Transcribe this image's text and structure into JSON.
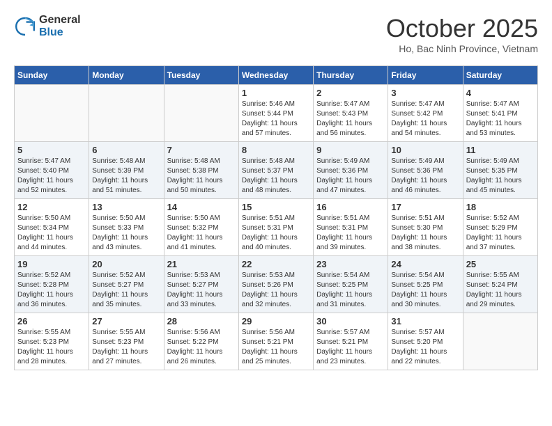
{
  "header": {
    "logo_general": "General",
    "logo_blue": "Blue",
    "month_title": "October 2025",
    "location": "Ho, Bac Ninh Province, Vietnam"
  },
  "days_of_week": [
    "Sunday",
    "Monday",
    "Tuesday",
    "Wednesday",
    "Thursday",
    "Friday",
    "Saturday"
  ],
  "weeks": [
    [
      {
        "day": "",
        "sunrise": "",
        "sunset": "",
        "daylight": ""
      },
      {
        "day": "",
        "sunrise": "",
        "sunset": "",
        "daylight": ""
      },
      {
        "day": "",
        "sunrise": "",
        "sunset": "",
        "daylight": ""
      },
      {
        "day": "1",
        "sunrise": "Sunrise: 5:46 AM",
        "sunset": "Sunset: 5:44 PM",
        "daylight": "Daylight: 11 hours and 57 minutes."
      },
      {
        "day": "2",
        "sunrise": "Sunrise: 5:47 AM",
        "sunset": "Sunset: 5:43 PM",
        "daylight": "Daylight: 11 hours and 56 minutes."
      },
      {
        "day": "3",
        "sunrise": "Sunrise: 5:47 AM",
        "sunset": "Sunset: 5:42 PM",
        "daylight": "Daylight: 11 hours and 54 minutes."
      },
      {
        "day": "4",
        "sunrise": "Sunrise: 5:47 AM",
        "sunset": "Sunset: 5:41 PM",
        "daylight": "Daylight: 11 hours and 53 minutes."
      }
    ],
    [
      {
        "day": "5",
        "sunrise": "Sunrise: 5:47 AM",
        "sunset": "Sunset: 5:40 PM",
        "daylight": "Daylight: 11 hours and 52 minutes."
      },
      {
        "day": "6",
        "sunrise": "Sunrise: 5:48 AM",
        "sunset": "Sunset: 5:39 PM",
        "daylight": "Daylight: 11 hours and 51 minutes."
      },
      {
        "day": "7",
        "sunrise": "Sunrise: 5:48 AM",
        "sunset": "Sunset: 5:38 PM",
        "daylight": "Daylight: 11 hours and 50 minutes."
      },
      {
        "day": "8",
        "sunrise": "Sunrise: 5:48 AM",
        "sunset": "Sunset: 5:37 PM",
        "daylight": "Daylight: 11 hours and 48 minutes."
      },
      {
        "day": "9",
        "sunrise": "Sunrise: 5:49 AM",
        "sunset": "Sunset: 5:36 PM",
        "daylight": "Daylight: 11 hours and 47 minutes."
      },
      {
        "day": "10",
        "sunrise": "Sunrise: 5:49 AM",
        "sunset": "Sunset: 5:36 PM",
        "daylight": "Daylight: 11 hours and 46 minutes."
      },
      {
        "day": "11",
        "sunrise": "Sunrise: 5:49 AM",
        "sunset": "Sunset: 5:35 PM",
        "daylight": "Daylight: 11 hours and 45 minutes."
      }
    ],
    [
      {
        "day": "12",
        "sunrise": "Sunrise: 5:50 AM",
        "sunset": "Sunset: 5:34 PM",
        "daylight": "Daylight: 11 hours and 44 minutes."
      },
      {
        "day": "13",
        "sunrise": "Sunrise: 5:50 AM",
        "sunset": "Sunset: 5:33 PM",
        "daylight": "Daylight: 11 hours and 43 minutes."
      },
      {
        "day": "14",
        "sunrise": "Sunrise: 5:50 AM",
        "sunset": "Sunset: 5:32 PM",
        "daylight": "Daylight: 11 hours and 41 minutes."
      },
      {
        "day": "15",
        "sunrise": "Sunrise: 5:51 AM",
        "sunset": "Sunset: 5:31 PM",
        "daylight": "Daylight: 11 hours and 40 minutes."
      },
      {
        "day": "16",
        "sunrise": "Sunrise: 5:51 AM",
        "sunset": "Sunset: 5:31 PM",
        "daylight": "Daylight: 11 hours and 39 minutes."
      },
      {
        "day": "17",
        "sunrise": "Sunrise: 5:51 AM",
        "sunset": "Sunset: 5:30 PM",
        "daylight": "Daylight: 11 hours and 38 minutes."
      },
      {
        "day": "18",
        "sunrise": "Sunrise: 5:52 AM",
        "sunset": "Sunset: 5:29 PM",
        "daylight": "Daylight: 11 hours and 37 minutes."
      }
    ],
    [
      {
        "day": "19",
        "sunrise": "Sunrise: 5:52 AM",
        "sunset": "Sunset: 5:28 PM",
        "daylight": "Daylight: 11 hours and 36 minutes."
      },
      {
        "day": "20",
        "sunrise": "Sunrise: 5:52 AM",
        "sunset": "Sunset: 5:27 PM",
        "daylight": "Daylight: 11 hours and 35 minutes."
      },
      {
        "day": "21",
        "sunrise": "Sunrise: 5:53 AM",
        "sunset": "Sunset: 5:27 PM",
        "daylight": "Daylight: 11 hours and 33 minutes."
      },
      {
        "day": "22",
        "sunrise": "Sunrise: 5:53 AM",
        "sunset": "Sunset: 5:26 PM",
        "daylight": "Daylight: 11 hours and 32 minutes."
      },
      {
        "day": "23",
        "sunrise": "Sunrise: 5:54 AM",
        "sunset": "Sunset: 5:25 PM",
        "daylight": "Daylight: 11 hours and 31 minutes."
      },
      {
        "day": "24",
        "sunrise": "Sunrise: 5:54 AM",
        "sunset": "Sunset: 5:25 PM",
        "daylight": "Daylight: 11 hours and 30 minutes."
      },
      {
        "day": "25",
        "sunrise": "Sunrise: 5:55 AM",
        "sunset": "Sunset: 5:24 PM",
        "daylight": "Daylight: 11 hours and 29 minutes."
      }
    ],
    [
      {
        "day": "26",
        "sunrise": "Sunrise: 5:55 AM",
        "sunset": "Sunset: 5:23 PM",
        "daylight": "Daylight: 11 hours and 28 minutes."
      },
      {
        "day": "27",
        "sunrise": "Sunrise: 5:55 AM",
        "sunset": "Sunset: 5:23 PM",
        "daylight": "Daylight: 11 hours and 27 minutes."
      },
      {
        "day": "28",
        "sunrise": "Sunrise: 5:56 AM",
        "sunset": "Sunset: 5:22 PM",
        "daylight": "Daylight: 11 hours and 26 minutes."
      },
      {
        "day": "29",
        "sunrise": "Sunrise: 5:56 AM",
        "sunset": "Sunset: 5:21 PM",
        "daylight": "Daylight: 11 hours and 25 minutes."
      },
      {
        "day": "30",
        "sunrise": "Sunrise: 5:57 AM",
        "sunset": "Sunset: 5:21 PM",
        "daylight": "Daylight: 11 hours and 23 minutes."
      },
      {
        "day": "31",
        "sunrise": "Sunrise: 5:57 AM",
        "sunset": "Sunset: 5:20 PM",
        "daylight": "Daylight: 11 hours and 22 minutes."
      },
      {
        "day": "",
        "sunrise": "",
        "sunset": "",
        "daylight": ""
      }
    ]
  ]
}
